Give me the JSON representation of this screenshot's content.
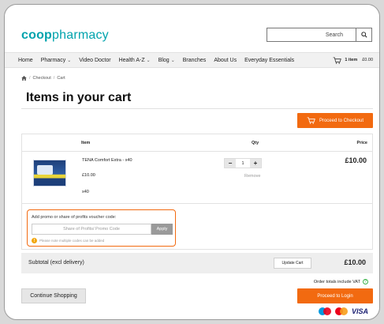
{
  "header": {
    "logo_coop": "coop",
    "logo_pharmacy": "pharmacy",
    "search_placeholder": "Search",
    "search_icon": "magnifier-icon"
  },
  "nav": {
    "items": [
      {
        "label": "Home",
        "dropdown": false
      },
      {
        "label": "Pharmacy",
        "dropdown": true
      },
      {
        "label": "Video Doctor",
        "dropdown": false
      },
      {
        "label": "Health A-Z",
        "dropdown": true
      },
      {
        "label": "Blog",
        "dropdown": true
      },
      {
        "label": "Branches",
        "dropdown": false
      },
      {
        "label": "About Us",
        "dropdown": false
      },
      {
        "label": "Everyday Essentials",
        "dropdown": false
      }
    ],
    "cart_count": "1 item",
    "cart_total": "£0.00"
  },
  "breadcrumb": {
    "home_icon": "home-icon",
    "items": [
      "Checkout",
      "Cart"
    ]
  },
  "page_title": "Items in your cart",
  "proceed_checkout_label": "Proceed to Checkout",
  "table": {
    "headers": {
      "item": "Item",
      "qty": "Qty",
      "price": "Price"
    },
    "rows": [
      {
        "name": "TENA Comfort Extra - x40",
        "unit_price": "£10.00",
        "pack": "x40",
        "qty": "1",
        "remove_label": "Remove",
        "line_price": "£10.00"
      }
    ]
  },
  "promo": {
    "label": "Add promo or share of profits voucher code:",
    "placeholder": "Share of Profits/ Promo Code",
    "apply_label": "Apply",
    "note": "Please note multiple codes can be added"
  },
  "summary": {
    "subtotal_label": "Subtotal (excl delivery)",
    "update_label": "Update Cart",
    "subtotal_amount": "£10.00",
    "vat_note": "Order totals include VAT"
  },
  "continue_label": "Continue Shopping",
  "login_label": "Proceed to Login",
  "payment": {
    "visa": "VISA"
  },
  "colors": {
    "brand": "#00a3ad",
    "accent": "#f26a10"
  }
}
